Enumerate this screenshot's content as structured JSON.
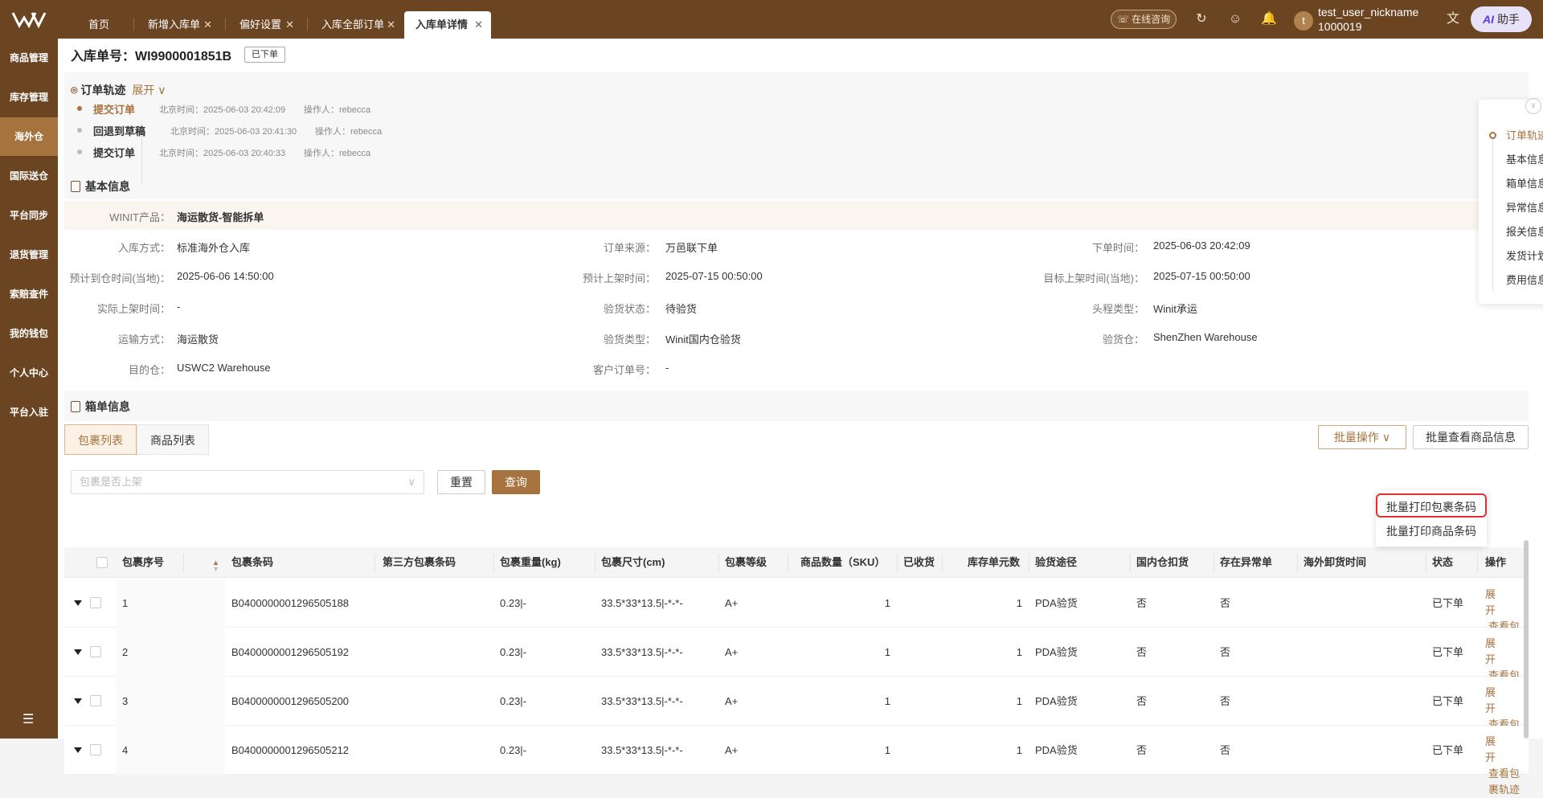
{
  "topbar": {
    "tabs": [
      {
        "label": "首页"
      },
      {
        "label": "新增入库单"
      },
      {
        "label": "偏好设置"
      },
      {
        "label": "入库全部订单"
      },
      {
        "label": "入库单详情"
      }
    ],
    "consult_label": "在线咨询",
    "avatar_letter": "t",
    "user_nickname": "test_user_nickname",
    "user_id": "1000019",
    "ai_label": "助手",
    "ai_mark": "AI"
  },
  "sidebar": {
    "items": [
      "商品管理",
      "库存管理",
      "海外仓",
      "国际送仓",
      "平台同步",
      "退货管理",
      "索赔查件",
      "我的钱包",
      "个人中心",
      "平台入驻"
    ],
    "active_index": 2
  },
  "page": {
    "title": "入库单号：WI9900001851B",
    "status_tag": "已下单"
  },
  "track": {
    "title": "订单轨迹",
    "expand_label": "展开",
    "events": [
      {
        "event": "提交订单",
        "time": "北京时间：2025-06-03 20:42:09",
        "operator": "操作人：rebecca"
      },
      {
        "event": "回退到草稿",
        "time": "北京时间：2025-06-03 20:41:30",
        "operator": "操作人：rebecca"
      },
      {
        "event": "提交订单",
        "time": "北京时间：2025-06-03 20:40:33",
        "operator": "操作人：rebecca"
      }
    ]
  },
  "basic": {
    "title": "基本信息",
    "product_label": "WINIT产品：",
    "product_value": "海运散货-智能拆单",
    "fields": [
      {
        "label": "入库方式：",
        "value": "标准海外仓入库"
      },
      {
        "label": "订单来源：",
        "value": "万邑联下单"
      },
      {
        "label": "下单时间：",
        "value": "2025-06-03 20:42:09"
      },
      {
        "label": "预计到仓时间(当地)：",
        "value": "2025-06-06 14:50:00"
      },
      {
        "label": "预计上架时间：",
        "value": "2025-07-15 00:50:00"
      },
      {
        "label": "目标上架时间(当地)：",
        "value": "2025-07-15 00:50:00"
      },
      {
        "label": "实际上架时间：",
        "value": "-"
      },
      {
        "label": "验货状态：",
        "value": "待验货"
      },
      {
        "label": "头程类型：",
        "value": "Winit承运"
      },
      {
        "label": "运输方式：",
        "value": "海运散货"
      },
      {
        "label": "验货类型：",
        "value": "Winit国内仓验货"
      },
      {
        "label": "验货仓：",
        "value": "ShenZhen Warehouse"
      },
      {
        "label": "目的仓：",
        "value": "USWC2 Warehouse"
      },
      {
        "label": "客户订单号：",
        "value": "-"
      }
    ]
  },
  "box": {
    "title": "箱单信息",
    "tabs": [
      "包裹列表",
      "商品列表"
    ],
    "filter_placeholder": "包裹是否上架",
    "reset_label": "重置",
    "query_label": "查询",
    "batch_label": "批量操作",
    "view_goods_label": "批量查看商品信息",
    "dropdown": [
      "批量打印包裹条码",
      "批量打印商品条码"
    ]
  },
  "table": {
    "headers": [
      "包裹序号",
      "包裹条码",
      "第三方包裹条码",
      "包裹重量(kg)",
      "包裹尺寸(cm)",
      "包裹等级",
      "商品数量（SKU）",
      "已收货",
      "库存单元数",
      "验货途径",
      "国内仓扣货",
      "存在异常单",
      "海外卸货时间",
      "状态",
      "操作"
    ],
    "rows": [
      {
        "seq": "1",
        "barcode": "B0400000001296505188",
        "third": "",
        "weight": "0.23|-",
        "size": "33.5*33*13.5|-*-*-",
        "grade": "A+",
        "qty": "1",
        "received": "",
        "units": "1",
        "inspect": "PDA验货",
        "hold": "否",
        "abnormal": "否",
        "unload": "",
        "status": "已下单",
        "op1": "展开",
        "op2": "查看包裹轨迹"
      },
      {
        "seq": "2",
        "barcode": "B0400000001296505192",
        "third": "",
        "weight": "0.23|-",
        "size": "33.5*33*13.5|-*-*-",
        "grade": "A+",
        "qty": "1",
        "received": "",
        "units": "1",
        "inspect": "PDA验货",
        "hold": "否",
        "abnormal": "否",
        "unload": "",
        "status": "已下单",
        "op1": "展开",
        "op2": "查看包裹轨迹"
      },
      {
        "seq": "3",
        "barcode": "B0400000001296505200",
        "third": "",
        "weight": "0.23|-",
        "size": "33.5*33*13.5|-*-*-",
        "grade": "A+",
        "qty": "1",
        "received": "",
        "units": "1",
        "inspect": "PDA验货",
        "hold": "否",
        "abnormal": "否",
        "unload": "",
        "status": "已下单",
        "op1": "展开",
        "op2": "查看包裹轨迹"
      },
      {
        "seq": "4",
        "barcode": "B0400000001296505212",
        "third": "",
        "weight": "0.23|-",
        "size": "33.5*33*13.5|-*-*-",
        "grade": "A+",
        "qty": "1",
        "received": "",
        "units": "1",
        "inspect": "PDA验货",
        "hold": "否",
        "abnormal": "否",
        "unload": "",
        "status": "已下单",
        "op1": "展开",
        "op2": "查看包裹轨迹"
      }
    ]
  },
  "anchor": {
    "items": [
      "订单轨迹",
      "基本信息",
      "箱单信息",
      "异常信息",
      "报关信息",
      "发货计划",
      "费用信息"
    ]
  },
  "colors": {
    "brand": "#6b4522",
    "accent": "#a6733e",
    "highlight": "#e03030"
  }
}
